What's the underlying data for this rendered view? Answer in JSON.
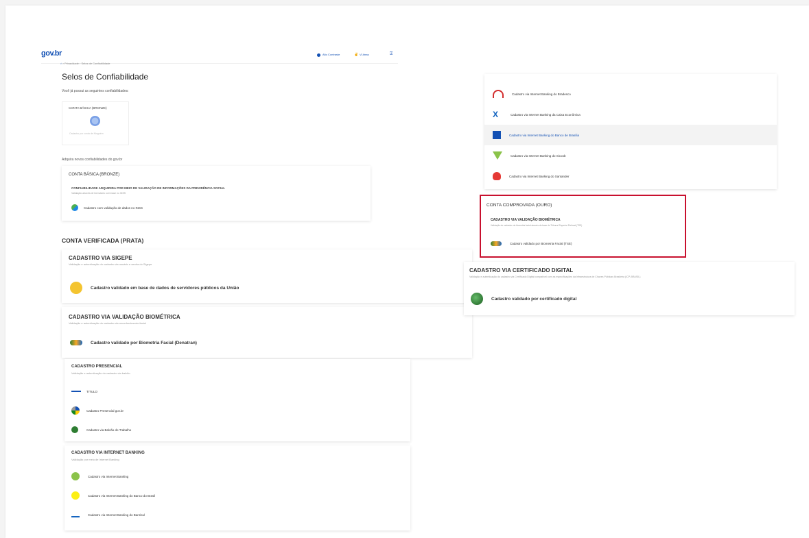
{
  "header": {
    "logo": "gov.br",
    "links": [
      "Alto Contraste",
      "VLibras"
    ],
    "breadcrumb": [
      "Privacidade",
      "Selos de Confiabilidade"
    ]
  },
  "page": {
    "title": "Selos de Confiabilidade",
    "owned_label": "Você já possui as seguintes confiabilidades:",
    "owned_seal": {
      "title": "CONTA BÁSICA (BRONZE)",
      "caption": "Cadastro por conta de Ninguém"
    },
    "acquire_label": "Adquira novos confiabilidades do gov.br"
  },
  "bronze": {
    "title": "CONTA BÁSICA (BRONZE)",
    "sub_title": "CONFIABILIDADE ADQUIRIDA POR MEIO DE VALIDAÇÃO DE INFORMAÇÕES DA PREVIDÊNCIA SOCIAL",
    "sub_desc": "Validação através de formulário com base no INSS",
    "item": "Cadastro com validação de dados no INSS"
  },
  "prata": {
    "title": "CONTA VERIFICADA (PRATA)",
    "sigepe": {
      "title": "CADASTRO VIA SIGEPE",
      "desc": "Validação e autenticação do cadastro via usuário e senha do Sigepe",
      "item": "Cadastro validado em base de dados de servidores públicos da União"
    },
    "bio": {
      "title": "CADASTRO VIA VALIDAÇÃO BIOMÉTRICA",
      "desc": "Validação e autenticação do cadastro via reconhecimento facial",
      "item": "Cadastro validado por Biometria Facial (Denatran)"
    },
    "presencial": {
      "title": "CADASTRO PRESENCIAL",
      "desc": "Validação e autenticação do cadastro via balcão",
      "tag": "TITULO",
      "items": [
        "Cadastro Presencial gov.br",
        "Cadastro via Balcão do Trabalho"
      ]
    },
    "banking": {
      "title": "CADASTRO VIA INTERNET BANKING",
      "desc": "Validação por meio de Internet Banking",
      "items": [
        "Cadastro via Internet Banking",
        "Cadastro via Internet Banking do Banco do Brasil",
        "Cadastro via Internet Banking do Banrisul"
      ]
    }
  },
  "banks_right": {
    "items": [
      "Cadastro via Internet Banking do Bradesco",
      "Cadastro via Internet Banking da Caixa Econômica",
      "Cadastro via Internet Banking do Banco de Brasília",
      "Cadastro via Internet Banking do Sicoob",
      "Cadastro via Internet Banking do Santander"
    ]
  },
  "ouro": {
    "title": "CONTA COMPROVADA (OURO)",
    "bio_title": "CADASTRO VIA VALIDAÇÃO BIOMÉTRICA",
    "bio_desc": "Validação do cadastro via biometria facial através da base do Tribunal Superior Eleitoral (TSE)",
    "bio_item": "Cadastro validado por Biometria Facial (TSE)",
    "cert_title": "CADASTRO VIA CERTIFICADO DIGITAL",
    "cert_desc": "Validação e autenticação do cadastro via Certificado Digital compatível com as especificações da Infraestrutura de Chaves Públicas Brasileira (ICP-BRASIL)",
    "cert_item": "Cadastro validado por certificado digital"
  },
  "colors": {
    "highlight_border": "#c8102e",
    "gov_blue": "#1351b4",
    "gov_yellow": "#ffcd07",
    "gov_green": "#168821"
  }
}
